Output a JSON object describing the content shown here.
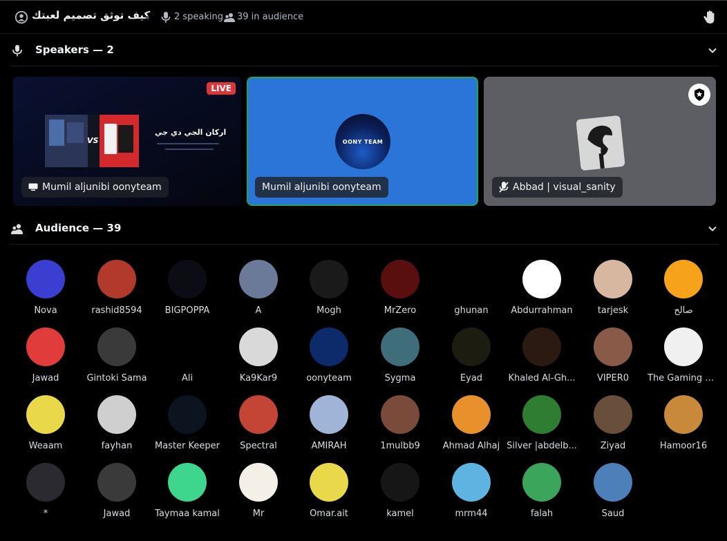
{
  "header": {
    "stage_title": "كيف توثق تصميم لعبتك",
    "speaking": "2 speaking",
    "audience": "39 in audience"
  },
  "speakers_section": {
    "label": "Speakers — 2"
  },
  "audience_section": {
    "label": "Audience — 39"
  },
  "speakers": [
    {
      "name": "Mumil aljunibi oonyteam",
      "badge": "LIVE",
      "stream_title": "اركان الجي دي جي",
      "stream_vs": "VS"
    },
    {
      "name": "Mumil aljunibi oonyteam",
      "avatar_text": "OONY TEAM"
    },
    {
      "name": "Abbad | visual_sanity"
    }
  ],
  "audience": [
    {
      "name": "Nova",
      "color": "#3b3fd1"
    },
    {
      "name": "rashid8594",
      "color": "#b23a2c"
    },
    {
      "name": "BIGPOPPA",
      "color": "#0c0c14"
    },
    {
      "name": "A",
      "color": "#6c7a9a"
    },
    {
      "name": "Mogh",
      "color": "#1a1a1a"
    },
    {
      "name": "MrZero",
      "color": "#5a0f0f"
    },
    {
      "name": "ghunan",
      "color": "#000000"
    },
    {
      "name": "Abdurrahman",
      "color": "#ffffff"
    },
    {
      "name": "tarjesk",
      "color": "#d7b7a0"
    },
    {
      "name": "صالح",
      "color": "#f6a21b"
    },
    {
      "name": "Jawad",
      "color": "#e03c3c"
    },
    {
      "name": "Gintoki Sama",
      "color": "#3a3a3a"
    },
    {
      "name": "Ali",
      "color": "#000000"
    },
    {
      "name": "Ka9Kar9",
      "color": "#d9d9d9"
    },
    {
      "name": "oonyteam",
      "color": "#0d2a6b"
    },
    {
      "name": "Sygma",
      "color": "#3f6e7a"
    },
    {
      "name": "Eyad",
      "color": "#1c1c10"
    },
    {
      "name": "Khaled Al-Gh...",
      "color": "#2a1a12"
    },
    {
      "name": "VIPER0",
      "color": "#8a5a48"
    },
    {
      "name": "The Gaming N...",
      "color": "#f0f0f0"
    },
    {
      "name": "Weaam",
      "color": "#e9d84a"
    },
    {
      "name": "fayhan",
      "color": "#cfcfcf"
    },
    {
      "name": "Master Keeper",
      "color": "#0c1420"
    },
    {
      "name": "Spectral",
      "color": "#c44535"
    },
    {
      "name": "AMIRAH",
      "color": "#9fb4d6"
    },
    {
      "name": "1mulbb9",
      "color": "#7a4a3a"
    },
    {
      "name": "Ahmad Alhaj",
      "color": "#e8902c"
    },
    {
      "name": "Silver |abdelb...",
      "color": "#2e7d32"
    },
    {
      "name": "Ziyad",
      "color": "#6a4e3c"
    },
    {
      "name": "Hamoor16",
      "color": "#c88a3a"
    },
    {
      "name": "*",
      "color": "#2a2a30"
    },
    {
      "name": "Jawad",
      "color": "#3a3a3a"
    },
    {
      "name": "Taymaa kamal",
      "color": "#3dd68c"
    },
    {
      "name": "Mr",
      "color": "#f4f0e8"
    },
    {
      "name": "Omar.ait",
      "color": "#e9d84a"
    },
    {
      "name": "kamel",
      "color": "#161616"
    },
    {
      "name": "mrm44",
      "color": "#5fb3e0"
    },
    {
      "name": "falah",
      "color": "#3ba55c"
    },
    {
      "name": "Saud",
      "color": "#4d7fb8"
    }
  ],
  "colors": {
    "background": "#000000",
    "live": "#da373c",
    "speaking_border": "#23a559",
    "tile_blue": "#2b75d8"
  }
}
